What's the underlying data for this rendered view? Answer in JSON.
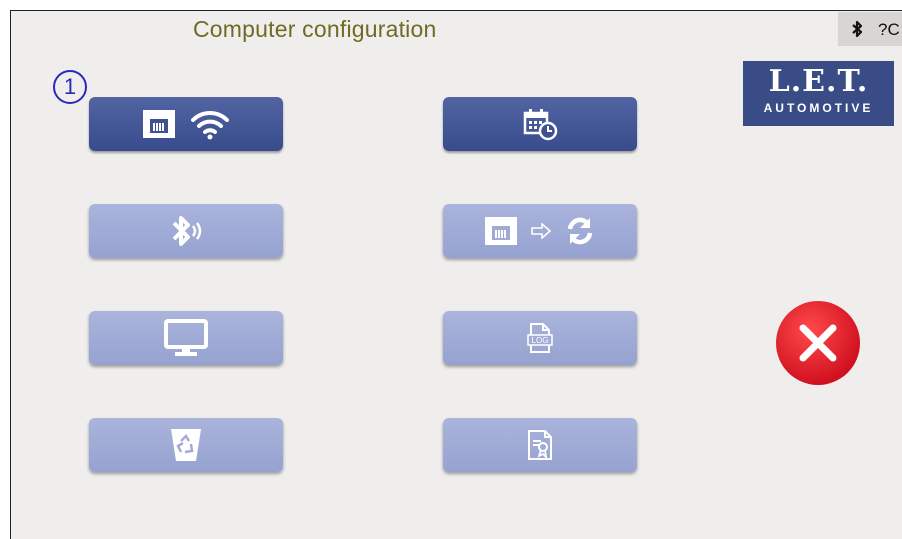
{
  "header": {
    "title": "Computer configuration",
    "status_text": "?C"
  },
  "logo": {
    "line1": "L.E.T.",
    "line2": "AUTOMOTIVE"
  },
  "step_badge": "1",
  "buttons": [
    {
      "icon": "network-wifi-icon",
      "state": "active"
    },
    {
      "icon": "calendar-clock-icon",
      "state": "active"
    },
    {
      "icon": "bluetooth-icon",
      "state": "inactive"
    },
    {
      "icon": "network-sync-icon",
      "state": "inactive"
    },
    {
      "icon": "monitor-icon",
      "state": "inactive"
    },
    {
      "icon": "log-file-icon",
      "state": "inactive"
    },
    {
      "icon": "recycle-bin-icon",
      "state": "inactive"
    },
    {
      "icon": "certificate-icon",
      "state": "inactive"
    }
  ],
  "close_button": {
    "icon": "close-icon",
    "color": "#e0202a"
  },
  "colors": {
    "background": "#f0eeec",
    "title": "#6f6a25",
    "button_active": "#3f5190",
    "button_inactive": "#a1acd6",
    "logo_bg": "#3a4c86"
  }
}
